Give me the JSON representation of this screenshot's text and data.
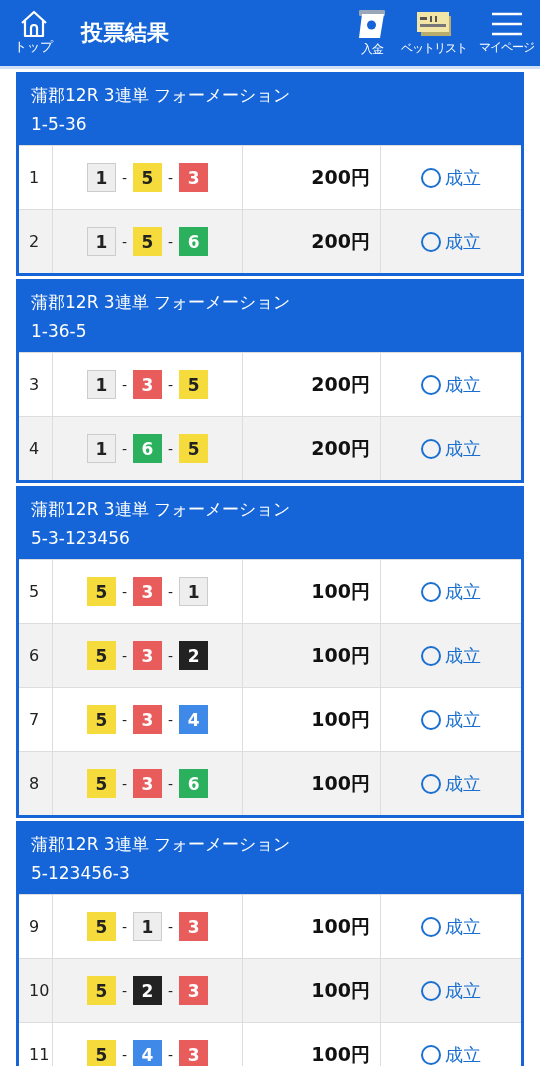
{
  "header": {
    "home_label": "トップ",
    "title": "投票結果",
    "nav": [
      {
        "kind": "deposit",
        "label": "入金"
      },
      {
        "kind": "betlist",
        "label": "ベットリスト"
      },
      {
        "kind": "menu",
        "label": "マイページ"
      }
    ]
  },
  "combo_separator": "-",
  "sections": [
    {
      "title": "蒲郡12R 3連単 フォーメーション",
      "subtitle": "1-5-36",
      "rows": [
        {
          "index": "1",
          "combo": [
            {
              "num": "1",
              "color": "#eeeeee"
            },
            {
              "num": "5",
              "color": "#f5dc3c"
            },
            {
              "num": "3",
              "color": "#e85c5c"
            }
          ],
          "amount": "200円",
          "status": "成立"
        },
        {
          "index": "2",
          "combo": [
            {
              "num": "1",
              "color": "#eeeeee"
            },
            {
              "num": "5",
              "color": "#f5dc3c"
            },
            {
              "num": "6",
              "color": "#2bb15e"
            }
          ],
          "amount": "200円",
          "status": "成立"
        }
      ]
    },
    {
      "title": "蒲郡12R 3連単 フォーメーション",
      "subtitle": "1-36-5",
      "rows": [
        {
          "index": "3",
          "combo": [
            {
              "num": "1",
              "color": "#eeeeee"
            },
            {
              "num": "3",
              "color": "#e85c5c"
            },
            {
              "num": "5",
              "color": "#f5dc3c"
            }
          ],
          "amount": "200円",
          "status": "成立"
        },
        {
          "index": "4",
          "combo": [
            {
              "num": "1",
              "color": "#eeeeee"
            },
            {
              "num": "6",
              "color": "#2bb15e"
            },
            {
              "num": "5",
              "color": "#f5dc3c"
            }
          ],
          "amount": "200円",
          "status": "成立"
        }
      ]
    },
    {
      "title": "蒲郡12R 3連単 フォーメーション",
      "subtitle": "5-3-123456",
      "rows": [
        {
          "index": "5",
          "combo": [
            {
              "num": "5",
              "color": "#f5dc3c"
            },
            {
              "num": "3",
              "color": "#e85c5c"
            },
            {
              "num": "1",
              "color": "#eeeeee"
            }
          ],
          "amount": "100円",
          "status": "成立"
        },
        {
          "index": "6",
          "combo": [
            {
              "num": "5",
              "color": "#f5dc3c"
            },
            {
              "num": "3",
              "color": "#e85c5c"
            },
            {
              "num": "2",
              "color": "#222222"
            }
          ],
          "amount": "100円",
          "status": "成立"
        },
        {
          "index": "7",
          "combo": [
            {
              "num": "5",
              "color": "#f5dc3c"
            },
            {
              "num": "3",
              "color": "#e85c5c"
            },
            {
              "num": "4",
              "color": "#3f8ae8"
            }
          ],
          "amount": "100円",
          "status": "成立"
        },
        {
          "index": "8",
          "combo": [
            {
              "num": "5",
              "color": "#f5dc3c"
            },
            {
              "num": "3",
              "color": "#e85c5c"
            },
            {
              "num": "6",
              "color": "#2bb15e"
            }
          ],
          "amount": "100円",
          "status": "成立"
        }
      ]
    },
    {
      "title": "蒲郡12R 3連単 フォーメーション",
      "subtitle": "5-123456-3",
      "rows": [
        {
          "index": "9",
          "combo": [
            {
              "num": "5",
              "color": "#f5dc3c"
            },
            {
              "num": "1",
              "color": "#eeeeee"
            },
            {
              "num": "3",
              "color": "#e85c5c"
            }
          ],
          "amount": "100円",
          "status": "成立"
        },
        {
          "index": "10",
          "combo": [
            {
              "num": "5",
              "color": "#f5dc3c"
            },
            {
              "num": "2",
              "color": "#222222"
            },
            {
              "num": "3",
              "color": "#e85c5c"
            }
          ],
          "amount": "100円",
          "status": "成立"
        },
        {
          "index": "11",
          "combo": [
            {
              "num": "5",
              "color": "#f5dc3c"
            },
            {
              "num": "4",
              "color": "#3f8ae8"
            },
            {
              "num": "3",
              "color": "#e85c5c"
            }
          ],
          "amount": "100円",
          "status": "成立"
        }
      ]
    }
  ]
}
